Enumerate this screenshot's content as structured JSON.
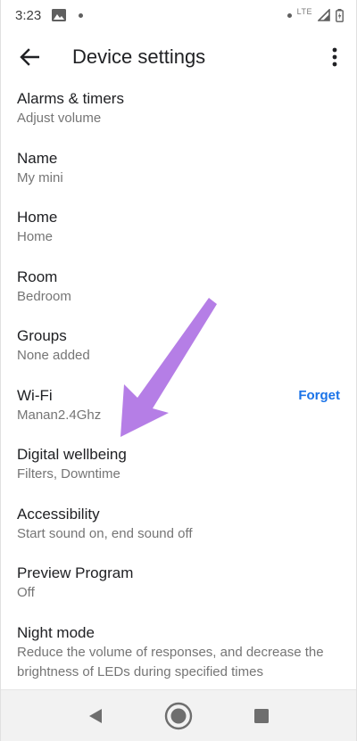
{
  "status_bar": {
    "time": "3:23",
    "network": "LTE"
  },
  "app_bar": {
    "title": "Device settings"
  },
  "settings": [
    {
      "title": "Alarms & timers",
      "subtitle": "Adjust volume"
    },
    {
      "title": "Name",
      "subtitle": "My mini"
    },
    {
      "title": "Home",
      "subtitle": "Home"
    },
    {
      "title": "Room",
      "subtitle": "Bedroom"
    },
    {
      "title": "Groups",
      "subtitle": "None added"
    },
    {
      "title": "Wi-Fi",
      "subtitle": "Manan2.4Ghz",
      "action": "Forget"
    },
    {
      "title": "Digital wellbeing",
      "subtitle": "Filters, Downtime"
    },
    {
      "title": "Accessibility",
      "subtitle": "Start sound on, end sound off"
    },
    {
      "title": "Preview Program",
      "subtitle": "Off"
    },
    {
      "title": "Night mode",
      "subtitle": "Reduce the volume of responses, and decrease the brightness of LEDs during specified times"
    }
  ],
  "colors": {
    "accent": "#1a73e8",
    "annotation_arrow": "#b57ee6"
  }
}
